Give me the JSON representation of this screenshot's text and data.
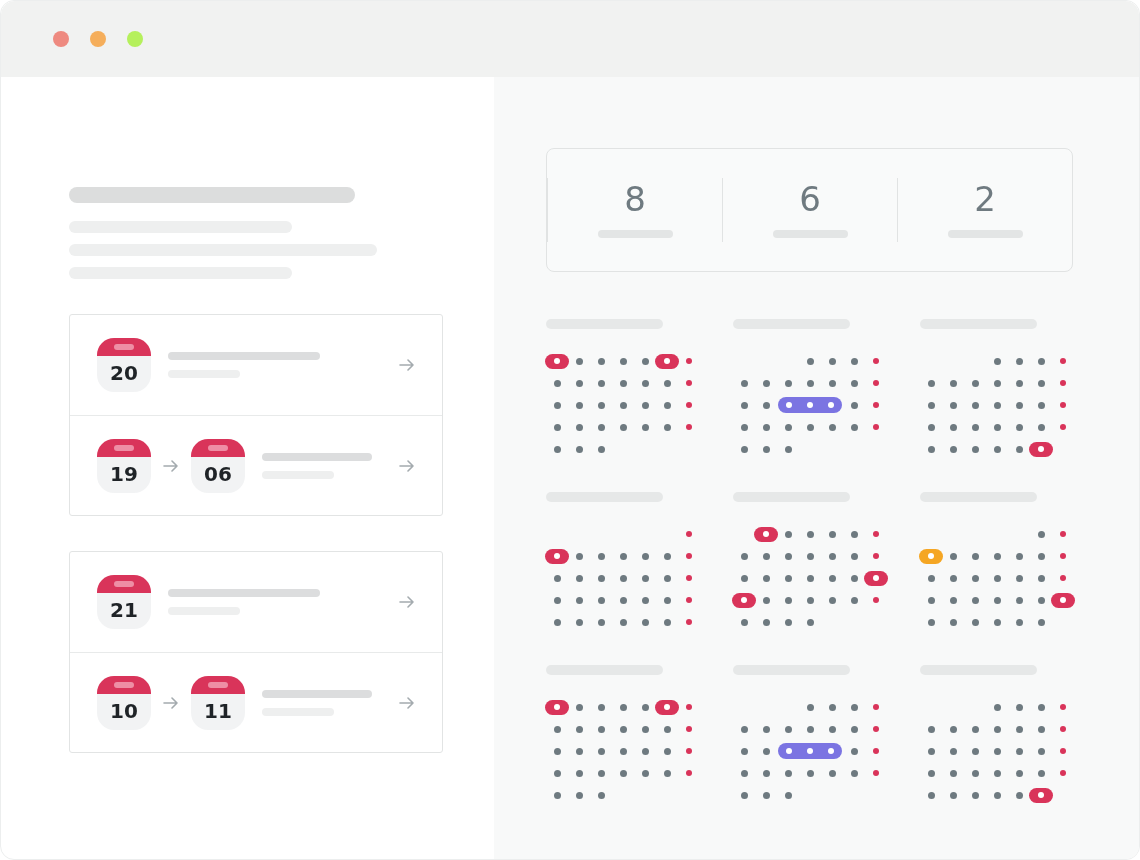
{
  "window": {
    "controls": [
      {
        "color": "#ee8a80"
      },
      {
        "color": "#f5ae5b"
      },
      {
        "color": "#b5f05c"
      }
    ]
  },
  "event_groups": [
    {
      "items": [
        {
          "dates": [
            "20"
          ]
        },
        {
          "dates": [
            "19",
            "06"
          ]
        }
      ]
    },
    {
      "items": [
        {
          "dates": [
            "21"
          ]
        },
        {
          "dates": [
            "10",
            "11"
          ]
        }
      ]
    }
  ],
  "stats": [
    {
      "value": "8"
    },
    {
      "value": "6"
    },
    {
      "value": "2"
    }
  ],
  "months": [
    {
      "weeks": [
        {
          "days": [
            {
              "kind": "event",
              "color": "#d9345a"
            },
            {
              "kind": "day"
            },
            {
              "kind": "day"
            },
            {
              "kind": "day"
            },
            {
              "kind": "day"
            },
            {
              "kind": "event",
              "color": "#d9345a"
            },
            {
              "kind": "weekend"
            }
          ]
        },
        {
          "days": [
            {
              "kind": "day"
            },
            {
              "kind": "day"
            },
            {
              "kind": "day"
            },
            {
              "kind": "day"
            },
            {
              "kind": "day"
            },
            {
              "kind": "day"
            },
            {
              "kind": "weekend"
            }
          ]
        },
        {
          "days": [
            {
              "kind": "day"
            },
            {
              "kind": "day"
            },
            {
              "kind": "day"
            },
            {
              "kind": "day"
            },
            {
              "kind": "day"
            },
            {
              "kind": "day"
            },
            {
              "kind": "weekend"
            }
          ]
        },
        {
          "days": [
            {
              "kind": "day"
            },
            {
              "kind": "day"
            },
            {
              "kind": "day"
            },
            {
              "kind": "day"
            },
            {
              "kind": "day"
            },
            {
              "kind": "day"
            },
            {
              "kind": "weekend"
            }
          ]
        },
        {
          "days": [
            {
              "kind": "day"
            },
            {
              "kind": "day"
            },
            {
              "kind": "day"
            }
          ]
        }
      ]
    },
    {
      "weeks": [
        {
          "days": [
            {
              "kind": "blank"
            },
            {
              "kind": "blank"
            },
            {
              "kind": "blank"
            },
            {
              "kind": "day"
            },
            {
              "kind": "day"
            },
            {
              "kind": "day"
            },
            {
              "kind": "weekend"
            }
          ]
        },
        {
          "days": [
            {
              "kind": "day"
            },
            {
              "kind": "day"
            },
            {
              "kind": "day"
            },
            {
              "kind": "day"
            },
            {
              "kind": "day"
            },
            {
              "kind": "day"
            },
            {
              "kind": "weekend"
            }
          ]
        },
        {
          "days": [
            {
              "kind": "day"
            },
            {
              "kind": "day"
            },
            {
              "kind": "range-start",
              "color": "#7b74e2"
            },
            {
              "kind": "range-mid"
            },
            {
              "kind": "range-end"
            },
            {
              "kind": "day"
            },
            {
              "kind": "weekend"
            }
          ]
        },
        {
          "days": [
            {
              "kind": "day"
            },
            {
              "kind": "day"
            },
            {
              "kind": "day"
            },
            {
              "kind": "day"
            },
            {
              "kind": "day"
            },
            {
              "kind": "day"
            },
            {
              "kind": "weekend"
            }
          ]
        },
        {
          "days": [
            {
              "kind": "day"
            },
            {
              "kind": "day"
            },
            {
              "kind": "day"
            }
          ]
        }
      ]
    },
    {
      "weeks": [
        {
          "days": [
            {
              "kind": "blank"
            },
            {
              "kind": "blank"
            },
            {
              "kind": "blank"
            },
            {
              "kind": "day"
            },
            {
              "kind": "day"
            },
            {
              "kind": "day"
            },
            {
              "kind": "weekend"
            }
          ]
        },
        {
          "days": [
            {
              "kind": "day"
            },
            {
              "kind": "day"
            },
            {
              "kind": "day"
            },
            {
              "kind": "day"
            },
            {
              "kind": "day"
            },
            {
              "kind": "day"
            },
            {
              "kind": "weekend"
            }
          ]
        },
        {
          "days": [
            {
              "kind": "day"
            },
            {
              "kind": "day"
            },
            {
              "kind": "day"
            },
            {
              "kind": "day"
            },
            {
              "kind": "day"
            },
            {
              "kind": "day"
            },
            {
              "kind": "weekend"
            }
          ]
        },
        {
          "days": [
            {
              "kind": "day"
            },
            {
              "kind": "day"
            },
            {
              "kind": "day"
            },
            {
              "kind": "day"
            },
            {
              "kind": "day"
            },
            {
              "kind": "day"
            },
            {
              "kind": "weekend"
            }
          ]
        },
        {
          "days": [
            {
              "kind": "day"
            },
            {
              "kind": "day"
            },
            {
              "kind": "day"
            },
            {
              "kind": "day"
            },
            {
              "kind": "day"
            },
            {
              "kind": "event",
              "color": "#d9345a"
            }
          ]
        }
      ]
    },
    {
      "weeks": [
        {
          "days": [
            {
              "kind": "blank"
            },
            {
              "kind": "blank"
            },
            {
              "kind": "blank"
            },
            {
              "kind": "blank"
            },
            {
              "kind": "blank"
            },
            {
              "kind": "blank"
            },
            {
              "kind": "weekend"
            }
          ]
        },
        {
          "days": [
            {
              "kind": "event",
              "color": "#d9345a"
            },
            {
              "kind": "day"
            },
            {
              "kind": "day"
            },
            {
              "kind": "day"
            },
            {
              "kind": "day"
            },
            {
              "kind": "day"
            },
            {
              "kind": "weekend"
            }
          ]
        },
        {
          "days": [
            {
              "kind": "day"
            },
            {
              "kind": "day"
            },
            {
              "kind": "day"
            },
            {
              "kind": "day"
            },
            {
              "kind": "day"
            },
            {
              "kind": "day"
            },
            {
              "kind": "weekend"
            }
          ]
        },
        {
          "days": [
            {
              "kind": "day"
            },
            {
              "kind": "day"
            },
            {
              "kind": "day"
            },
            {
              "kind": "day"
            },
            {
              "kind": "day"
            },
            {
              "kind": "day"
            },
            {
              "kind": "weekend"
            }
          ]
        },
        {
          "days": [
            {
              "kind": "day"
            },
            {
              "kind": "day"
            },
            {
              "kind": "day"
            },
            {
              "kind": "day"
            },
            {
              "kind": "day"
            },
            {
              "kind": "day"
            },
            {
              "kind": "weekend"
            }
          ]
        }
      ]
    },
    {
      "weeks": [
        {
          "days": [
            {
              "kind": "blank"
            },
            {
              "kind": "event",
              "color": "#d9345a"
            },
            {
              "kind": "day"
            },
            {
              "kind": "day"
            },
            {
              "kind": "day"
            },
            {
              "kind": "day"
            },
            {
              "kind": "weekend"
            }
          ]
        },
        {
          "days": [
            {
              "kind": "day"
            },
            {
              "kind": "day"
            },
            {
              "kind": "day"
            },
            {
              "kind": "day"
            },
            {
              "kind": "day"
            },
            {
              "kind": "day"
            },
            {
              "kind": "weekend"
            }
          ]
        },
        {
          "days": [
            {
              "kind": "day"
            },
            {
              "kind": "day"
            },
            {
              "kind": "day"
            },
            {
              "kind": "day"
            },
            {
              "kind": "day"
            },
            {
              "kind": "day"
            },
            {
              "kind": "event",
              "color": "#d9345a"
            }
          ]
        },
        {
          "days": [
            {
              "kind": "event",
              "color": "#d9345a"
            },
            {
              "kind": "day"
            },
            {
              "kind": "day"
            },
            {
              "kind": "day"
            },
            {
              "kind": "day"
            },
            {
              "kind": "day"
            },
            {
              "kind": "weekend"
            }
          ]
        },
        {
          "days": [
            {
              "kind": "day"
            },
            {
              "kind": "day"
            },
            {
              "kind": "day"
            },
            {
              "kind": "day"
            }
          ]
        }
      ]
    },
    {
      "weeks": [
        {
          "days": [
            {
              "kind": "blank"
            },
            {
              "kind": "blank"
            },
            {
              "kind": "blank"
            },
            {
              "kind": "blank"
            },
            {
              "kind": "blank"
            },
            {
              "kind": "day"
            },
            {
              "kind": "weekend"
            }
          ]
        },
        {
          "days": [
            {
              "kind": "event",
              "color": "#f5a623"
            },
            {
              "kind": "day"
            },
            {
              "kind": "day"
            },
            {
              "kind": "day"
            },
            {
              "kind": "day"
            },
            {
              "kind": "day"
            },
            {
              "kind": "weekend"
            }
          ]
        },
        {
          "days": [
            {
              "kind": "day"
            },
            {
              "kind": "day"
            },
            {
              "kind": "day"
            },
            {
              "kind": "day"
            },
            {
              "kind": "day"
            },
            {
              "kind": "day"
            },
            {
              "kind": "weekend"
            }
          ]
        },
        {
          "days": [
            {
              "kind": "day"
            },
            {
              "kind": "day"
            },
            {
              "kind": "day"
            },
            {
              "kind": "day"
            },
            {
              "kind": "day"
            },
            {
              "kind": "day"
            },
            {
              "kind": "event",
              "color": "#d9345a"
            }
          ]
        },
        {
          "days": [
            {
              "kind": "day"
            },
            {
              "kind": "day"
            },
            {
              "kind": "day"
            },
            {
              "kind": "day"
            },
            {
              "kind": "day"
            },
            {
              "kind": "day"
            }
          ]
        }
      ]
    },
    {
      "weeks": [
        {
          "days": [
            {
              "kind": "event",
              "color": "#d9345a"
            },
            {
              "kind": "day"
            },
            {
              "kind": "day"
            },
            {
              "kind": "day"
            },
            {
              "kind": "day"
            },
            {
              "kind": "event",
              "color": "#d9345a"
            },
            {
              "kind": "weekend"
            }
          ]
        },
        {
          "days": [
            {
              "kind": "day"
            },
            {
              "kind": "day"
            },
            {
              "kind": "day"
            },
            {
              "kind": "day"
            },
            {
              "kind": "day"
            },
            {
              "kind": "day"
            },
            {
              "kind": "weekend"
            }
          ]
        },
        {
          "days": [
            {
              "kind": "day"
            },
            {
              "kind": "day"
            },
            {
              "kind": "day"
            },
            {
              "kind": "day"
            },
            {
              "kind": "day"
            },
            {
              "kind": "day"
            },
            {
              "kind": "weekend"
            }
          ]
        },
        {
          "days": [
            {
              "kind": "day"
            },
            {
              "kind": "day"
            },
            {
              "kind": "day"
            },
            {
              "kind": "day"
            },
            {
              "kind": "day"
            },
            {
              "kind": "day"
            },
            {
              "kind": "weekend"
            }
          ]
        },
        {
          "days": [
            {
              "kind": "day"
            },
            {
              "kind": "day"
            },
            {
              "kind": "day"
            }
          ]
        }
      ]
    },
    {
      "weeks": [
        {
          "days": [
            {
              "kind": "blank"
            },
            {
              "kind": "blank"
            },
            {
              "kind": "blank"
            },
            {
              "kind": "day"
            },
            {
              "kind": "day"
            },
            {
              "kind": "day"
            },
            {
              "kind": "weekend"
            }
          ]
        },
        {
          "days": [
            {
              "kind": "day"
            },
            {
              "kind": "day"
            },
            {
              "kind": "day"
            },
            {
              "kind": "day"
            },
            {
              "kind": "day"
            },
            {
              "kind": "day"
            },
            {
              "kind": "weekend"
            }
          ]
        },
        {
          "days": [
            {
              "kind": "day"
            },
            {
              "kind": "day"
            },
            {
              "kind": "range-start",
              "color": "#7b74e2"
            },
            {
              "kind": "range-mid"
            },
            {
              "kind": "range-end"
            },
            {
              "kind": "day"
            },
            {
              "kind": "weekend"
            }
          ]
        },
        {
          "days": [
            {
              "kind": "day"
            },
            {
              "kind": "day"
            },
            {
              "kind": "day"
            },
            {
              "kind": "day"
            },
            {
              "kind": "day"
            },
            {
              "kind": "day"
            },
            {
              "kind": "weekend"
            }
          ]
        },
        {
          "days": [
            {
              "kind": "day"
            },
            {
              "kind": "day"
            },
            {
              "kind": "day"
            }
          ]
        }
      ]
    },
    {
      "weeks": [
        {
          "days": [
            {
              "kind": "blank"
            },
            {
              "kind": "blank"
            },
            {
              "kind": "blank"
            },
            {
              "kind": "day"
            },
            {
              "kind": "day"
            },
            {
              "kind": "day"
            },
            {
              "kind": "weekend"
            }
          ]
        },
        {
          "days": [
            {
              "kind": "day"
            },
            {
              "kind": "day"
            },
            {
              "kind": "day"
            },
            {
              "kind": "day"
            },
            {
              "kind": "day"
            },
            {
              "kind": "day"
            },
            {
              "kind": "weekend"
            }
          ]
        },
        {
          "days": [
            {
              "kind": "day"
            },
            {
              "kind": "day"
            },
            {
              "kind": "day"
            },
            {
              "kind": "day"
            },
            {
              "kind": "day"
            },
            {
              "kind": "day"
            },
            {
              "kind": "weekend"
            }
          ]
        },
        {
          "days": [
            {
              "kind": "day"
            },
            {
              "kind": "day"
            },
            {
              "kind": "day"
            },
            {
              "kind": "day"
            },
            {
              "kind": "day"
            },
            {
              "kind": "day"
            },
            {
              "kind": "weekend"
            }
          ]
        },
        {
          "days": [
            {
              "kind": "day"
            },
            {
              "kind": "day"
            },
            {
              "kind": "day"
            },
            {
              "kind": "day"
            },
            {
              "kind": "day"
            },
            {
              "kind": "event",
              "color": "#d9345a"
            }
          ]
        }
      ]
    }
  ]
}
